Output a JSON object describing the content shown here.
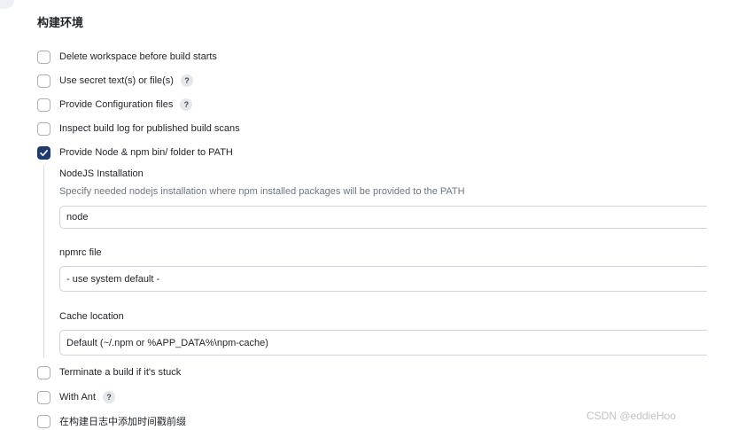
{
  "section": {
    "title": "构建环境"
  },
  "options_top": [
    {
      "label": "Delete workspace before build starts",
      "checked": false,
      "help": false
    },
    {
      "label": "Use secret text(s) or file(s)",
      "checked": false,
      "help": true
    },
    {
      "label": "Provide Configuration files",
      "checked": false,
      "help": true
    },
    {
      "label": "Inspect build log for published build scans",
      "checked": false,
      "help": false
    },
    {
      "label": "Provide Node & npm bin/ folder to PATH",
      "checked": true,
      "help": false
    }
  ],
  "node": {
    "installation_label": "NodeJS Installation",
    "installation_desc": "Specify needed nodejs installation where npm installed packages will be provided to the PATH",
    "installation_value": "node",
    "npmrc_label": "npmrc file",
    "npmrc_value": "- use system default -",
    "cache_label": "Cache location",
    "cache_value": "Default (~/.npm or %APP_DATA%\\npm-cache)"
  },
  "options_bottom": [
    {
      "label": "Terminate a build if it's stuck",
      "checked": false,
      "help": false
    },
    {
      "label": "With Ant",
      "checked": false,
      "help": true
    },
    {
      "label": "在构建日志中添加时间戳前缀",
      "checked": false,
      "help": false
    }
  ],
  "help_glyph": "?",
  "watermark": "CSDN @eddieHoo",
  "colors": {
    "checked_fill": "#1e3a6e",
    "checkbox_border": "#aab0b8",
    "muted_text": "#6f7782"
  }
}
